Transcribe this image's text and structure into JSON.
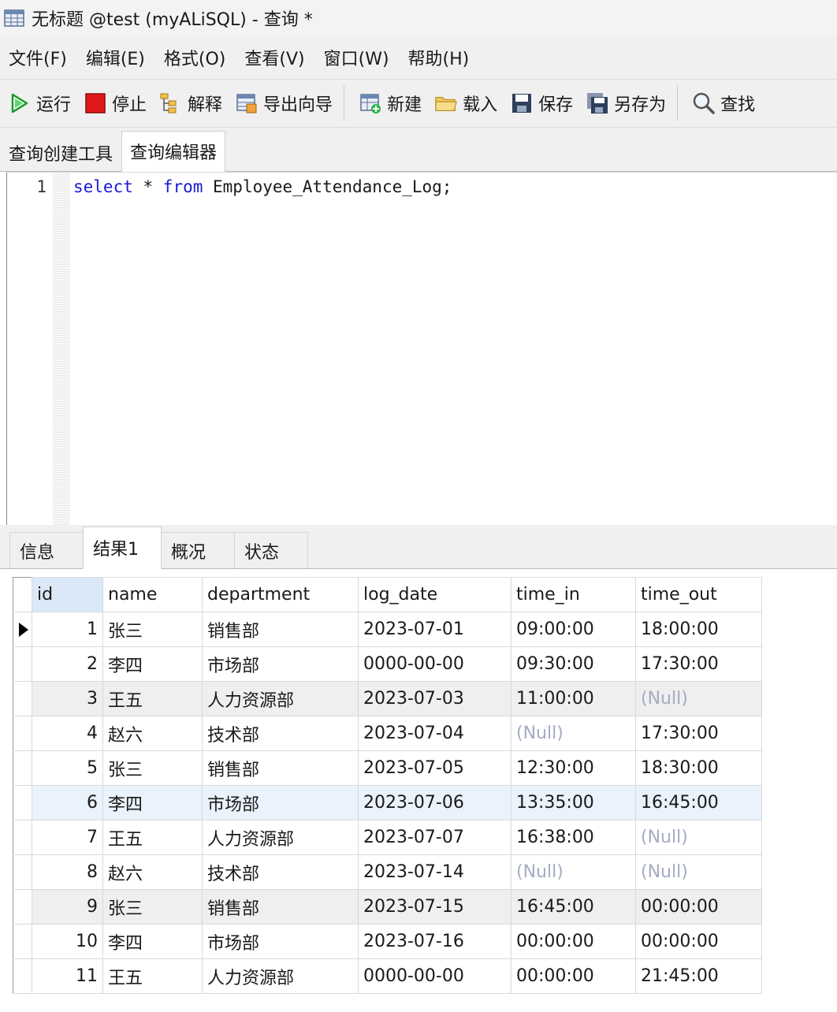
{
  "window": {
    "title": "无标题 @test (myALiSQL) - 查询 *",
    "icon": "table-grid-icon"
  },
  "menu": [
    {
      "label": "文件(F)"
    },
    {
      "label": "编辑(E)"
    },
    {
      "label": "格式(O)"
    },
    {
      "label": "查看(V)"
    },
    {
      "label": "窗口(W)"
    },
    {
      "label": "帮助(H)"
    }
  ],
  "toolbar": {
    "run": {
      "label": "运行",
      "icon": "play-icon"
    },
    "stop": {
      "label": "停止",
      "icon": "stop-icon"
    },
    "explain": {
      "label": "解释",
      "icon": "explain-tree-icon"
    },
    "export": {
      "label": "导出向导",
      "icon": "export-wizard-icon"
    },
    "new": {
      "label": "新建",
      "icon": "new-query-icon"
    },
    "load": {
      "label": "载入",
      "icon": "folder-open-icon"
    },
    "save": {
      "label": "保存",
      "icon": "save-icon"
    },
    "save_as": {
      "label": "另存为",
      "icon": "save-as-icon"
    },
    "find": {
      "label": "查找",
      "icon": "magnifier-icon"
    }
  },
  "editor_tabs": [
    {
      "label": "查询创建工具",
      "active": false
    },
    {
      "label": "查询编辑器",
      "active": true
    }
  ],
  "editor": {
    "line_number": "1",
    "code": {
      "kw1": "select",
      "star": " * ",
      "kw2": "from",
      "rest": " Employee_Attendance_Log;"
    }
  },
  "result_tabs": [
    {
      "label": "信息",
      "active": false
    },
    {
      "label": "结果1",
      "active": true
    },
    {
      "label": "概况",
      "active": false
    },
    {
      "label": "状态",
      "active": false
    }
  ],
  "grid": {
    "columns": [
      "id",
      "name",
      "department",
      "log_date",
      "time_in",
      "time_out"
    ],
    "null_text": "(Null)",
    "rows": [
      [
        "1",
        "张三",
        "销售部",
        "2023-07-01",
        "09:00:00",
        "18:00:00"
      ],
      [
        "2",
        "李四",
        "市场部",
        "0000-00-00",
        "09:30:00",
        "17:30:00"
      ],
      [
        "3",
        "王五",
        "人力资源部",
        "2023-07-03",
        "11:00:00",
        "(Null)"
      ],
      [
        "4",
        "赵六",
        "技术部",
        "2023-07-04",
        "(Null)",
        "17:30:00"
      ],
      [
        "5",
        "张三",
        "销售部",
        "2023-07-05",
        "12:30:00",
        "18:30:00"
      ],
      [
        "6",
        "李四",
        "市场部",
        "2023-07-06",
        "13:35:00",
        "16:45:00"
      ],
      [
        "7",
        "王五",
        "人力资源部",
        "2023-07-07",
        "16:38:00",
        "(Null)"
      ],
      [
        "8",
        "赵六",
        "技术部",
        "2023-07-14",
        "(Null)",
        "(Null)"
      ],
      [
        "9",
        "张三",
        "销售部",
        "2023-07-15",
        "16:45:00",
        "00:00:00"
      ],
      [
        "10",
        "李四",
        "市场部",
        "2023-07-16",
        "00:00:00",
        "00:00:00"
      ],
      [
        "11",
        "王五",
        "人力资源部",
        "0000-00-00",
        "00:00:00",
        "21:45:00"
      ]
    ]
  },
  "colors": {
    "keyword": "#1a1ad6",
    "null_text": "#a5abc2",
    "selected_header": "#dbe8f7",
    "hover_row": "#eaf2fc",
    "stripe_row": "#efefef"
  }
}
